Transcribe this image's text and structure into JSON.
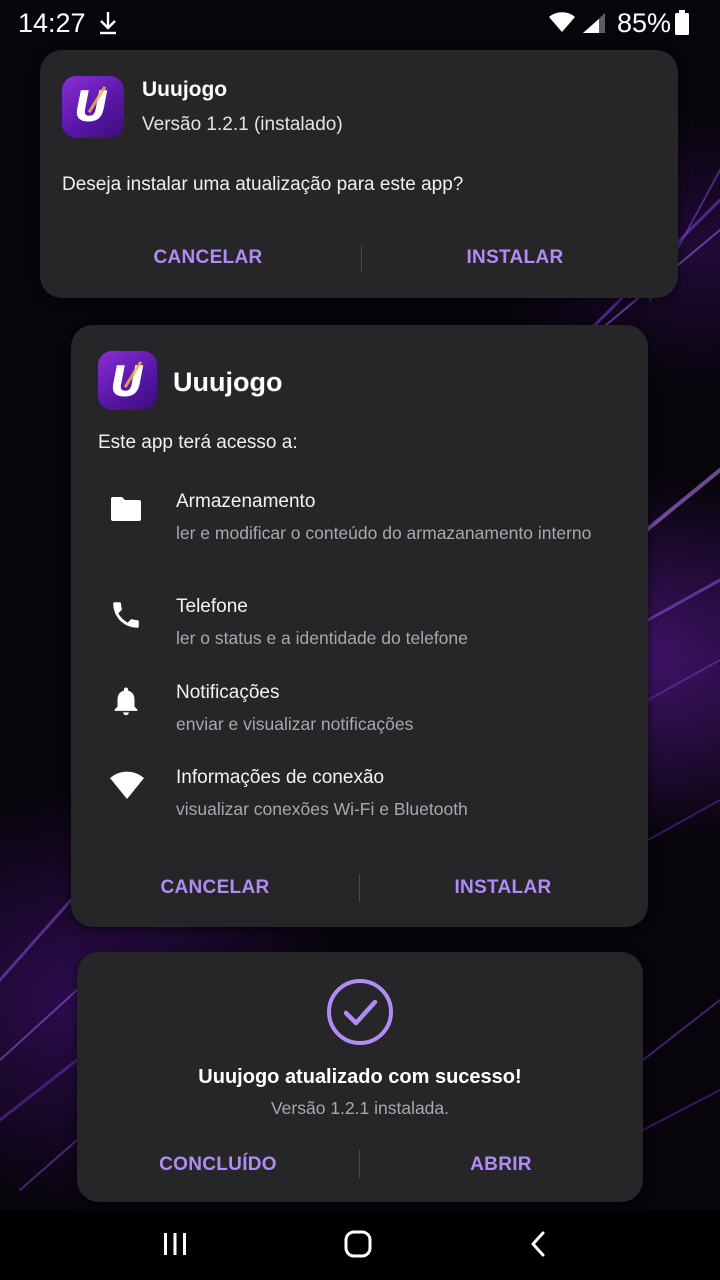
{
  "status_bar": {
    "time": "14:27",
    "battery": "85%",
    "icons": [
      "download-icon",
      "wifi-icon",
      "signal-icon",
      "battery-icon"
    ]
  },
  "theme": {
    "accent": "#b08cf6",
    "card_bg": "#262528",
    "secondary_text": "#a8a8ad",
    "app_icon": "#6a1fc0"
  },
  "update_dialog": {
    "app_name": "Uuujogo",
    "version": "Versão 1.2.1 (instalado)",
    "question": "Deseja instalar uma atualização para este app?",
    "cancel_label": "CANCELAR",
    "install_label": "INSTALAR"
  },
  "permissions_dialog": {
    "app_name": "Uuujogo",
    "intro": "Este app terá acesso a:",
    "permissions": [
      {
        "icon": "folder-icon",
        "title": "Armazenamento",
        "description": "ler e modificar o conteúdo do armazanamento interno"
      },
      {
        "icon": "phone-icon",
        "title": "Telefone",
        "description": "ler o status e a identidade do telefone"
      },
      {
        "icon": "bell-icon",
        "title": "Notificações",
        "description": "enviar e visualizar notificações"
      },
      {
        "icon": "wifi-icon",
        "title": "Informações de conexão",
        "description": "visualizar conexões Wi-Fi e Bluetooth"
      }
    ],
    "cancel_label": "CANCELAR",
    "install_label": "INSTALAR"
  },
  "success_dialog": {
    "title": "Uuujogo atualizado com sucesso!",
    "subtitle": "Versão 1.2.1 instalada.",
    "done_label": "CONCLUÍDO",
    "open_label": "ABRIR"
  },
  "nav_bar": {
    "buttons": [
      "recent-apps-icon",
      "home-icon",
      "back-icon"
    ]
  }
}
